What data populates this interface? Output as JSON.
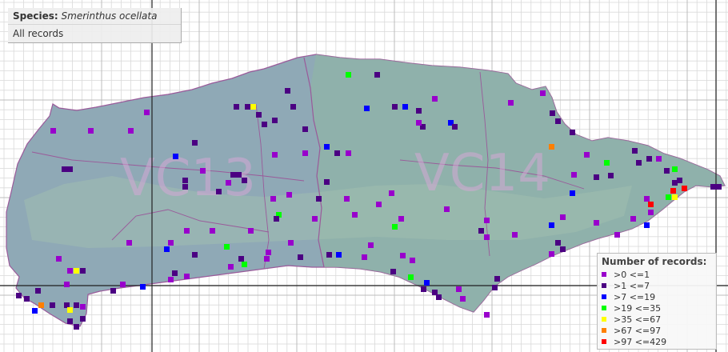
{
  "header": {
    "species_label": "Species:",
    "species_name": "Smerinthus ocellata",
    "records_label": "All records"
  },
  "regions": [
    {
      "label": "VC13"
    },
    {
      "label": "VC14"
    }
  ],
  "legend": {
    "title": "Number of records:",
    "classes": [
      {
        "label": ">0 <=1",
        "color": "#9900cc"
      },
      {
        "label": ">1 <=7",
        "color": "#4b0082"
      },
      {
        "label": ">7 <=19",
        "color": "#0000ff"
      },
      {
        "label": ">19 <=35",
        "color": "#00ff00"
      },
      {
        "label": ">35 <=67",
        "color": "#ffff00"
      },
      {
        "label": ">67 <=97",
        "color": "#ff7f00"
      },
      {
        "label": ">97 <=429",
        "color": "#ff0000"
      }
    ]
  },
  "colors": {
    "land_vc13": "#8da6b8",
    "land_vc14": "#8fb5a6",
    "background": "#ffffff",
    "grid_minor": "#d9d9d9",
    "grid_major": "#222222",
    "boundary": "#9a5a9a"
  }
}
